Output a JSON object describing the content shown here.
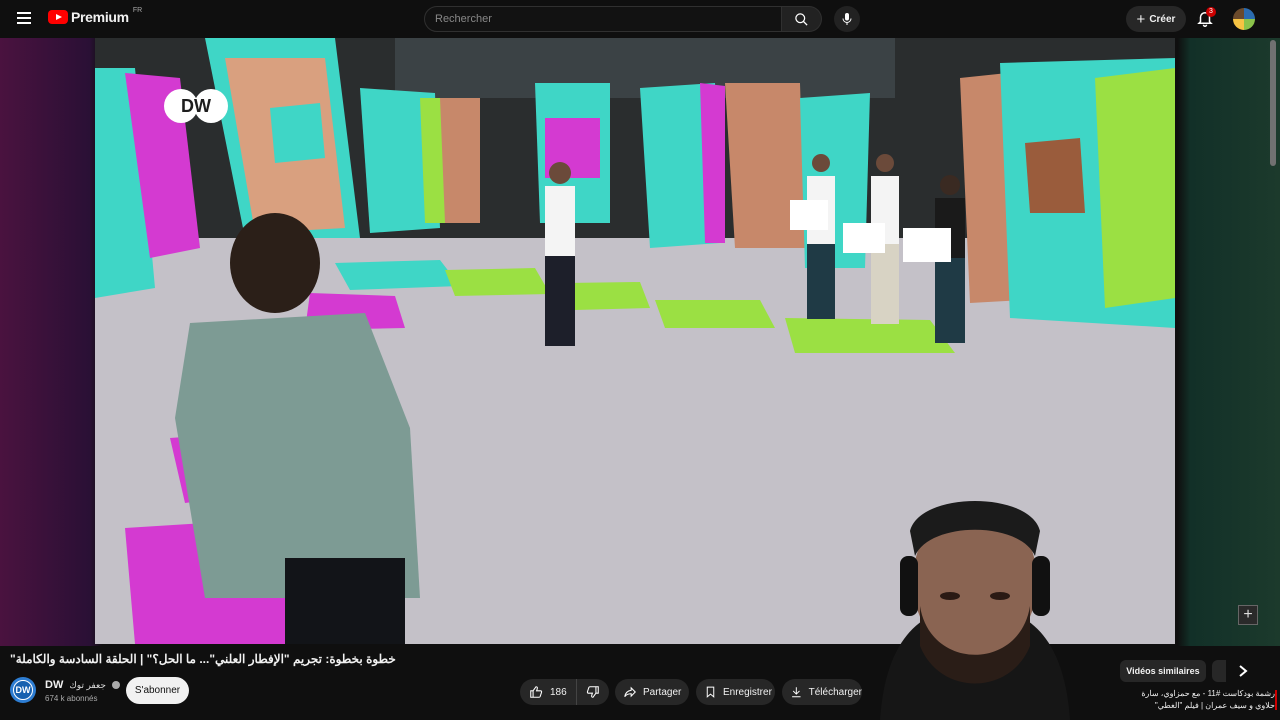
{
  "header": {
    "menu_icon": "hamburger-menu-icon",
    "logo_text": "Premium",
    "region": "FR",
    "search_placeholder": "Rechercher",
    "create_label": "Créer",
    "notification_count": "3"
  },
  "video": {
    "title": "خطوة بخطوة: تجريم \"الإفطار العلني\"... ما الحل؟\" | الحلقة السادسة والكاملة\"",
    "logo_text": "DW"
  },
  "channel": {
    "name": "DW",
    "name_suffix": "جعفر توك",
    "subscribers": "674 k abonnés",
    "subscribe_label": "S'abonner",
    "avatar_text": "DW"
  },
  "actions": {
    "like_count": "186",
    "share_label": "Partager",
    "save_label": "Enregistrer",
    "download_label": "Télécharger"
  },
  "sidebar": {
    "chip_label": "Vidéos similaires",
    "related_title": "رشمة بودكاست #11 - مع حمزاوي، سارة حلاوي و سيف عمران | فيلم \"الغطي\""
  },
  "colors": {
    "accent_red": "#ff0000",
    "background": "#0f0f0f",
    "pill": "#272727",
    "set_teal": "#3fd6c6",
    "set_magenta": "#d43ad1",
    "set_lime": "#9be043"
  }
}
